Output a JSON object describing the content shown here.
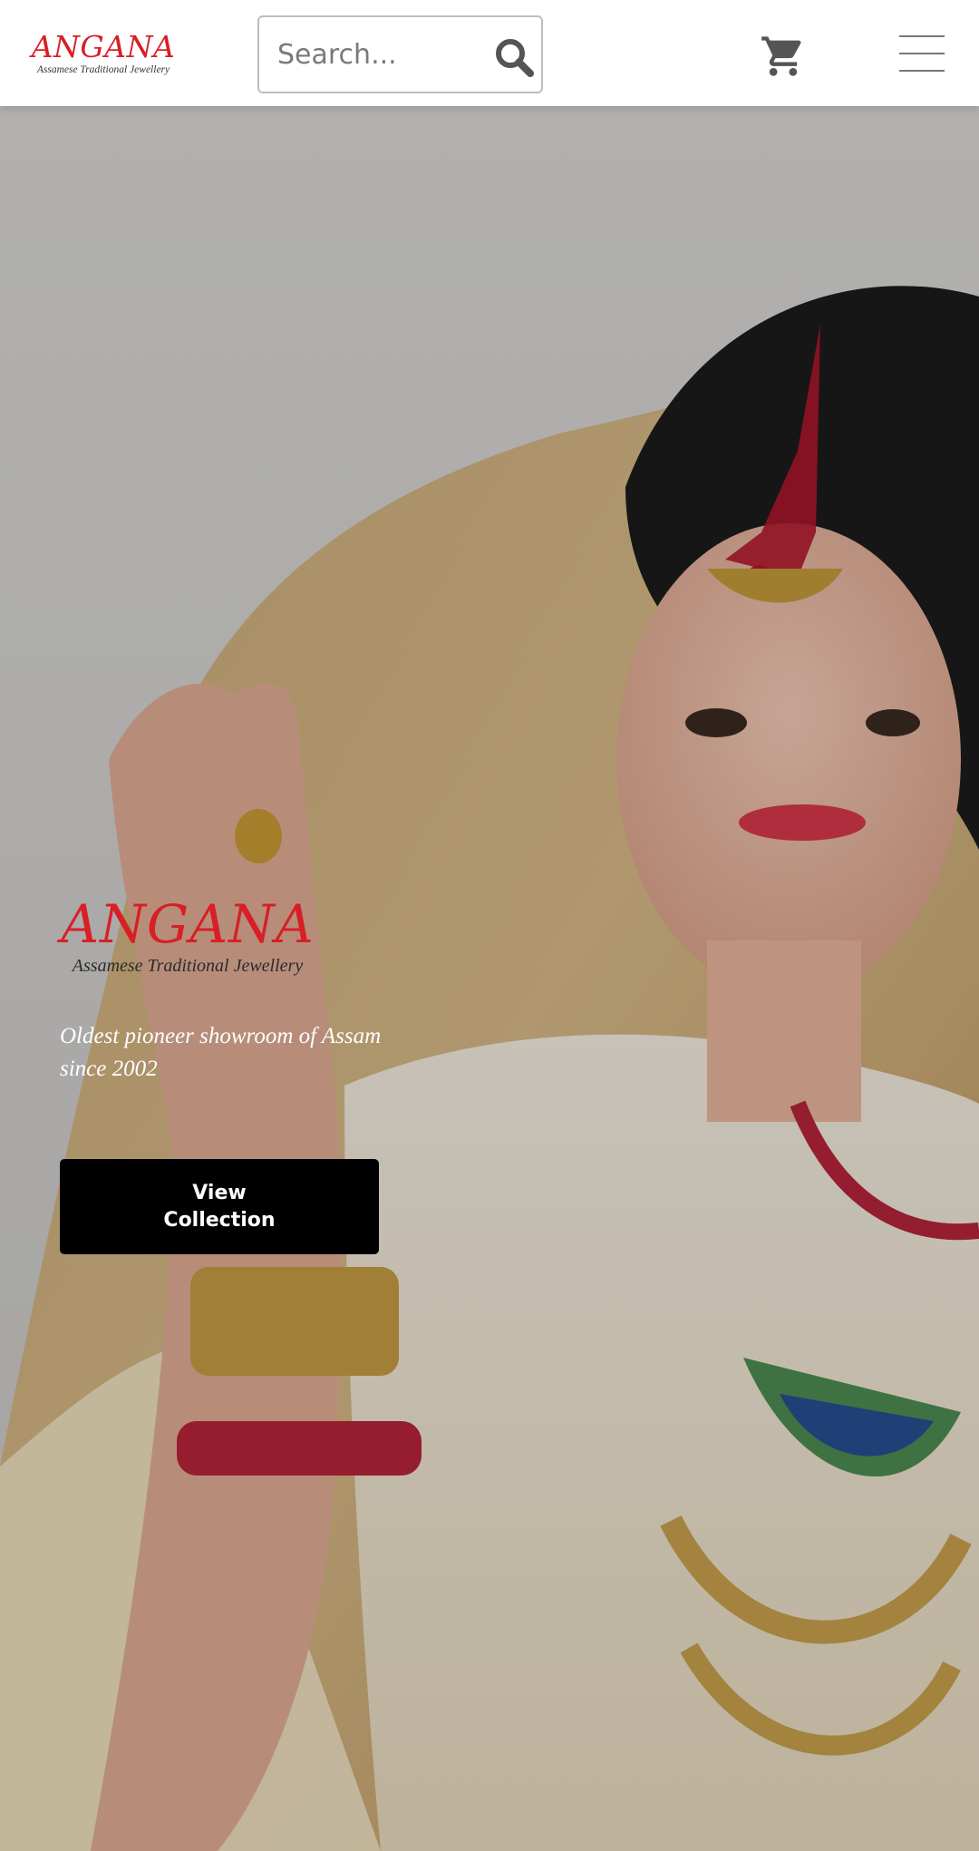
{
  "header": {
    "logo": {
      "title": "ANGANA",
      "subtitle": "Assamese Traditional Jewellery"
    },
    "search": {
      "placeholder": "Search..."
    },
    "icons": {
      "search": "search-icon",
      "cart": "cart-icon",
      "menu": "hamburger-menu-icon"
    }
  },
  "hero": {
    "logo": {
      "title": "ANGANA",
      "subtitle": "Assamese Traditional Jewellery"
    },
    "tagline": "Oldest pioneer showroom of Assam since 2002",
    "cta_label": "View Collection"
  },
  "colors": {
    "brand_red": "#d81f26",
    "button_bg": "#000000",
    "header_bg": "#ffffff"
  }
}
